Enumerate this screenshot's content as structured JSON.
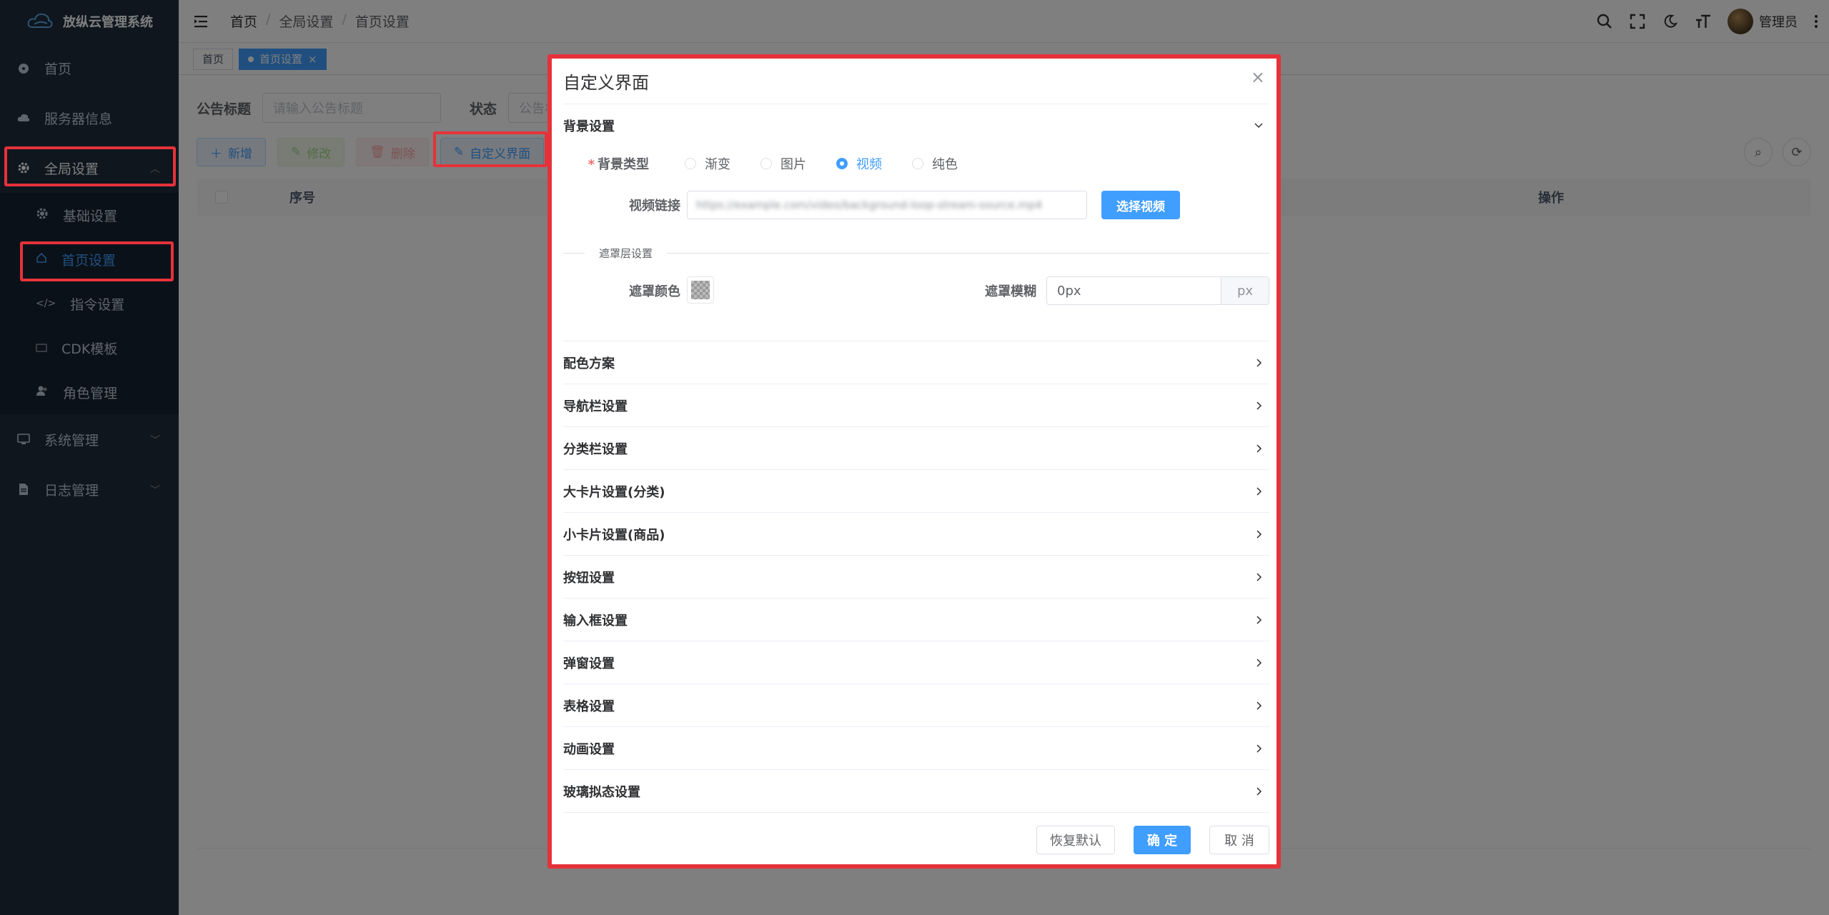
{
  "sidebar": {
    "logo_text": "放纵云管理系统",
    "items": [
      {
        "label": "首页",
        "icon": "dashboard-icon"
      },
      {
        "label": "服务器信息",
        "icon": "cloud-icon"
      },
      {
        "label": "全局设置",
        "icon": "gear-icon"
      }
    ],
    "sub_items": [
      {
        "label": "基础设置",
        "icon": "gear-icon"
      },
      {
        "label": "首页设置",
        "icon": "home-icon"
      },
      {
        "label": "指令设置",
        "icon": "code-icon"
      },
      {
        "label": "CDK模板",
        "icon": "ticket-icon"
      },
      {
        "label": "角色管理",
        "icon": "user-group-icon"
      }
    ],
    "bottom_items": [
      {
        "label": "系统管理",
        "icon": "monitor-icon"
      },
      {
        "label": "日志管理",
        "icon": "document-icon"
      }
    ]
  },
  "topbar": {
    "breadcrumb": [
      "首页",
      "全局设置",
      "首页设置"
    ],
    "breadcrumb_sep": "/",
    "username": "管理员"
  },
  "tags": {
    "home": "首页",
    "active": "首页设置",
    "close": "×"
  },
  "filters": {
    "title_label": "公告标题",
    "title_placeholder": "请输入公告标题",
    "status_label": "状态",
    "status_placeholder": "公告状"
  },
  "toolbar": {
    "add": "新增",
    "edit": "修改",
    "delete": "删除",
    "customize": "自定义界面"
  },
  "table": {
    "col_index": "序号",
    "col_actions": "操作"
  },
  "dialog": {
    "title": "自定义界面",
    "close": "×",
    "background_section": "背景设置",
    "bg_type_label": "背景类型",
    "bg_type_options": [
      "渐变",
      "图片",
      "视频",
      "纯色"
    ],
    "bg_type_selected": "视频",
    "video_link_label": "视频链接",
    "video_link_value": "https://example.com/video/background-loop-stream-source.mp4",
    "select_video": "选择视频",
    "mask_divider": "遮罩层设置",
    "mask_color_label": "遮罩颜色",
    "mask_blur_label": "遮罩模糊",
    "mask_blur_value": "0px",
    "mask_blur_unit": "px",
    "sections": [
      "配色方案",
      "导航栏设置",
      "分类栏设置",
      "大卡片设置(分类)",
      "小卡片设置(商品)",
      "按钮设置",
      "输入框设置",
      "弹窗设置",
      "表格设置",
      "动画设置",
      "玻璃拟态设置"
    ],
    "restore": "恢复默认",
    "confirm": "确 定",
    "cancel": "取 消"
  },
  "colors": {
    "sidebar_bg": "#1f2d3d",
    "primary": "#409eff",
    "highlight_red": "#e5323a"
  }
}
